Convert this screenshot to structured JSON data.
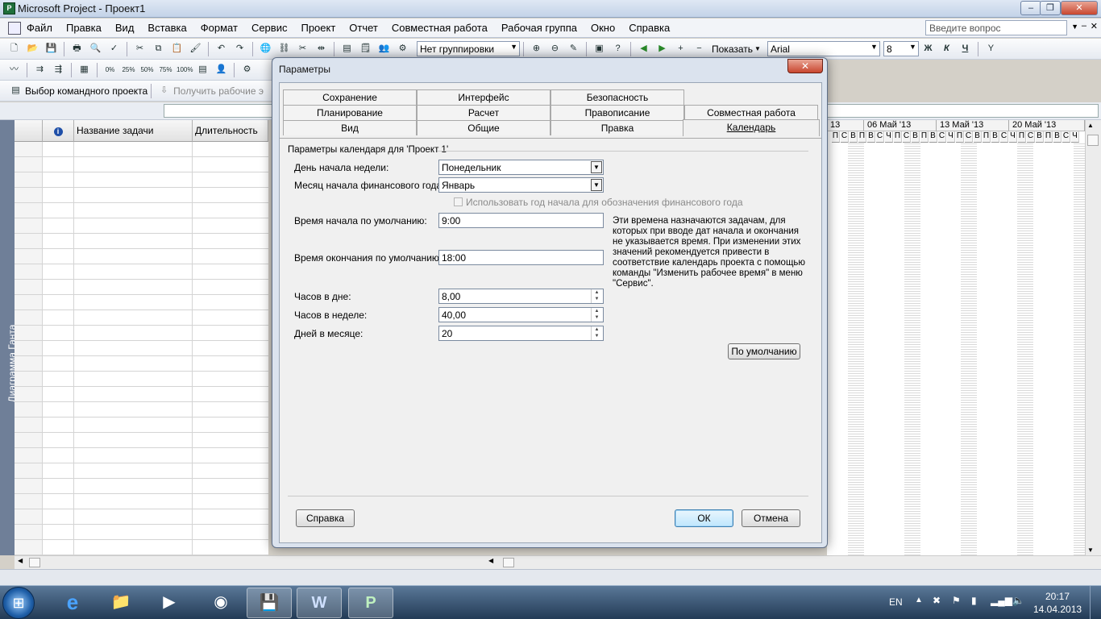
{
  "window": {
    "title": "Microsoft Project - Проект1",
    "controls": {
      "minimize": "–",
      "restore": "❐",
      "close": "✕"
    }
  },
  "menu": {
    "items": [
      "Файл",
      "Правка",
      "Вид",
      "Вставка",
      "Формат",
      "Сервис",
      "Проект",
      "Отчет",
      "Совместная работа",
      "Рабочая группа",
      "Окно",
      "Справка"
    ],
    "help_placeholder": "Введите вопрос"
  },
  "toolbar": {
    "grouping_value": "Нет группировки",
    "show_label": "Показать",
    "font_value": "Arial",
    "size_value": "8",
    "bold": "Ж",
    "italic": "К",
    "underline": "Ч",
    "percent_buttons": [
      "0%",
      "25%",
      "50%",
      "75%",
      "100%"
    ]
  },
  "toolbar3": {
    "team_project_button": "Выбор командного проекта",
    "get_work_button": "Получить рабочие э"
  },
  "viewbar": {
    "label": "Диаграмма Ганта"
  },
  "grid": {
    "headers": {
      "info": "i",
      "name": "Название задачи",
      "duration": "Длительность"
    }
  },
  "gantt": {
    "weeks": [
      "13",
      "06 Май '13",
      "13 Май '13",
      "20 Май '13"
    ],
    "day_letters": [
      "П",
      "С",
      "В",
      "П",
      "В",
      "С",
      "Ч",
      "П",
      "С",
      "В",
      "П",
      "В",
      "С",
      "Ч",
      "П",
      "С",
      "В",
      "П",
      "В",
      "С",
      "Ч",
      "П",
      "С",
      "В",
      "П",
      "В",
      "С",
      "Ч"
    ]
  },
  "dialog": {
    "title": "Параметры",
    "close": "✕",
    "tabs_row1": [
      "Сохранение",
      "Интерфейс",
      "Безопасность"
    ],
    "tabs_row2": [
      "Планирование",
      "Расчет",
      "Правописание",
      "Совместная работа"
    ],
    "tabs_row3": [
      "Вид",
      "Общие",
      "Правка",
      "Календарь"
    ],
    "section_title": "Параметры календаря для 'Проект 1'",
    "week_start_label": "День начала недели:",
    "week_start_value": "Понедельник",
    "fiscal_month_label": "Месяц начала финансового года:",
    "fiscal_month_value": "Январь",
    "fiscal_year_checkbox": "Использовать год начала для обозначения финансового года",
    "default_start_label": "Время начала по умолчанию:",
    "default_start_value": "9:00",
    "default_end_label": "Время окончания по умолчанию:",
    "default_end_value": "18:00",
    "note": "Эти времена назначаются задачам, для которых при вводе дат начала и окончания не указывается время. При изменении этих значений рекомендуется привести в соответствие календарь проекта с помощью команды \"Изменить рабочее время\" в меню \"Сервис\".",
    "hours_day_label": "Часов в дне:",
    "hours_day_value": "8,00",
    "hours_week_label": "Часов в неделе:",
    "hours_week_value": "40,00",
    "days_month_label": "Дней в месяце:",
    "days_month_value": "20",
    "default_button": "По умолчанию",
    "help_button": "Справка",
    "ok_button": "ОК",
    "cancel_button": "Отмена"
  },
  "taskbar": {
    "lang": "EN",
    "time": "20:17",
    "date": "14.04.2013"
  }
}
